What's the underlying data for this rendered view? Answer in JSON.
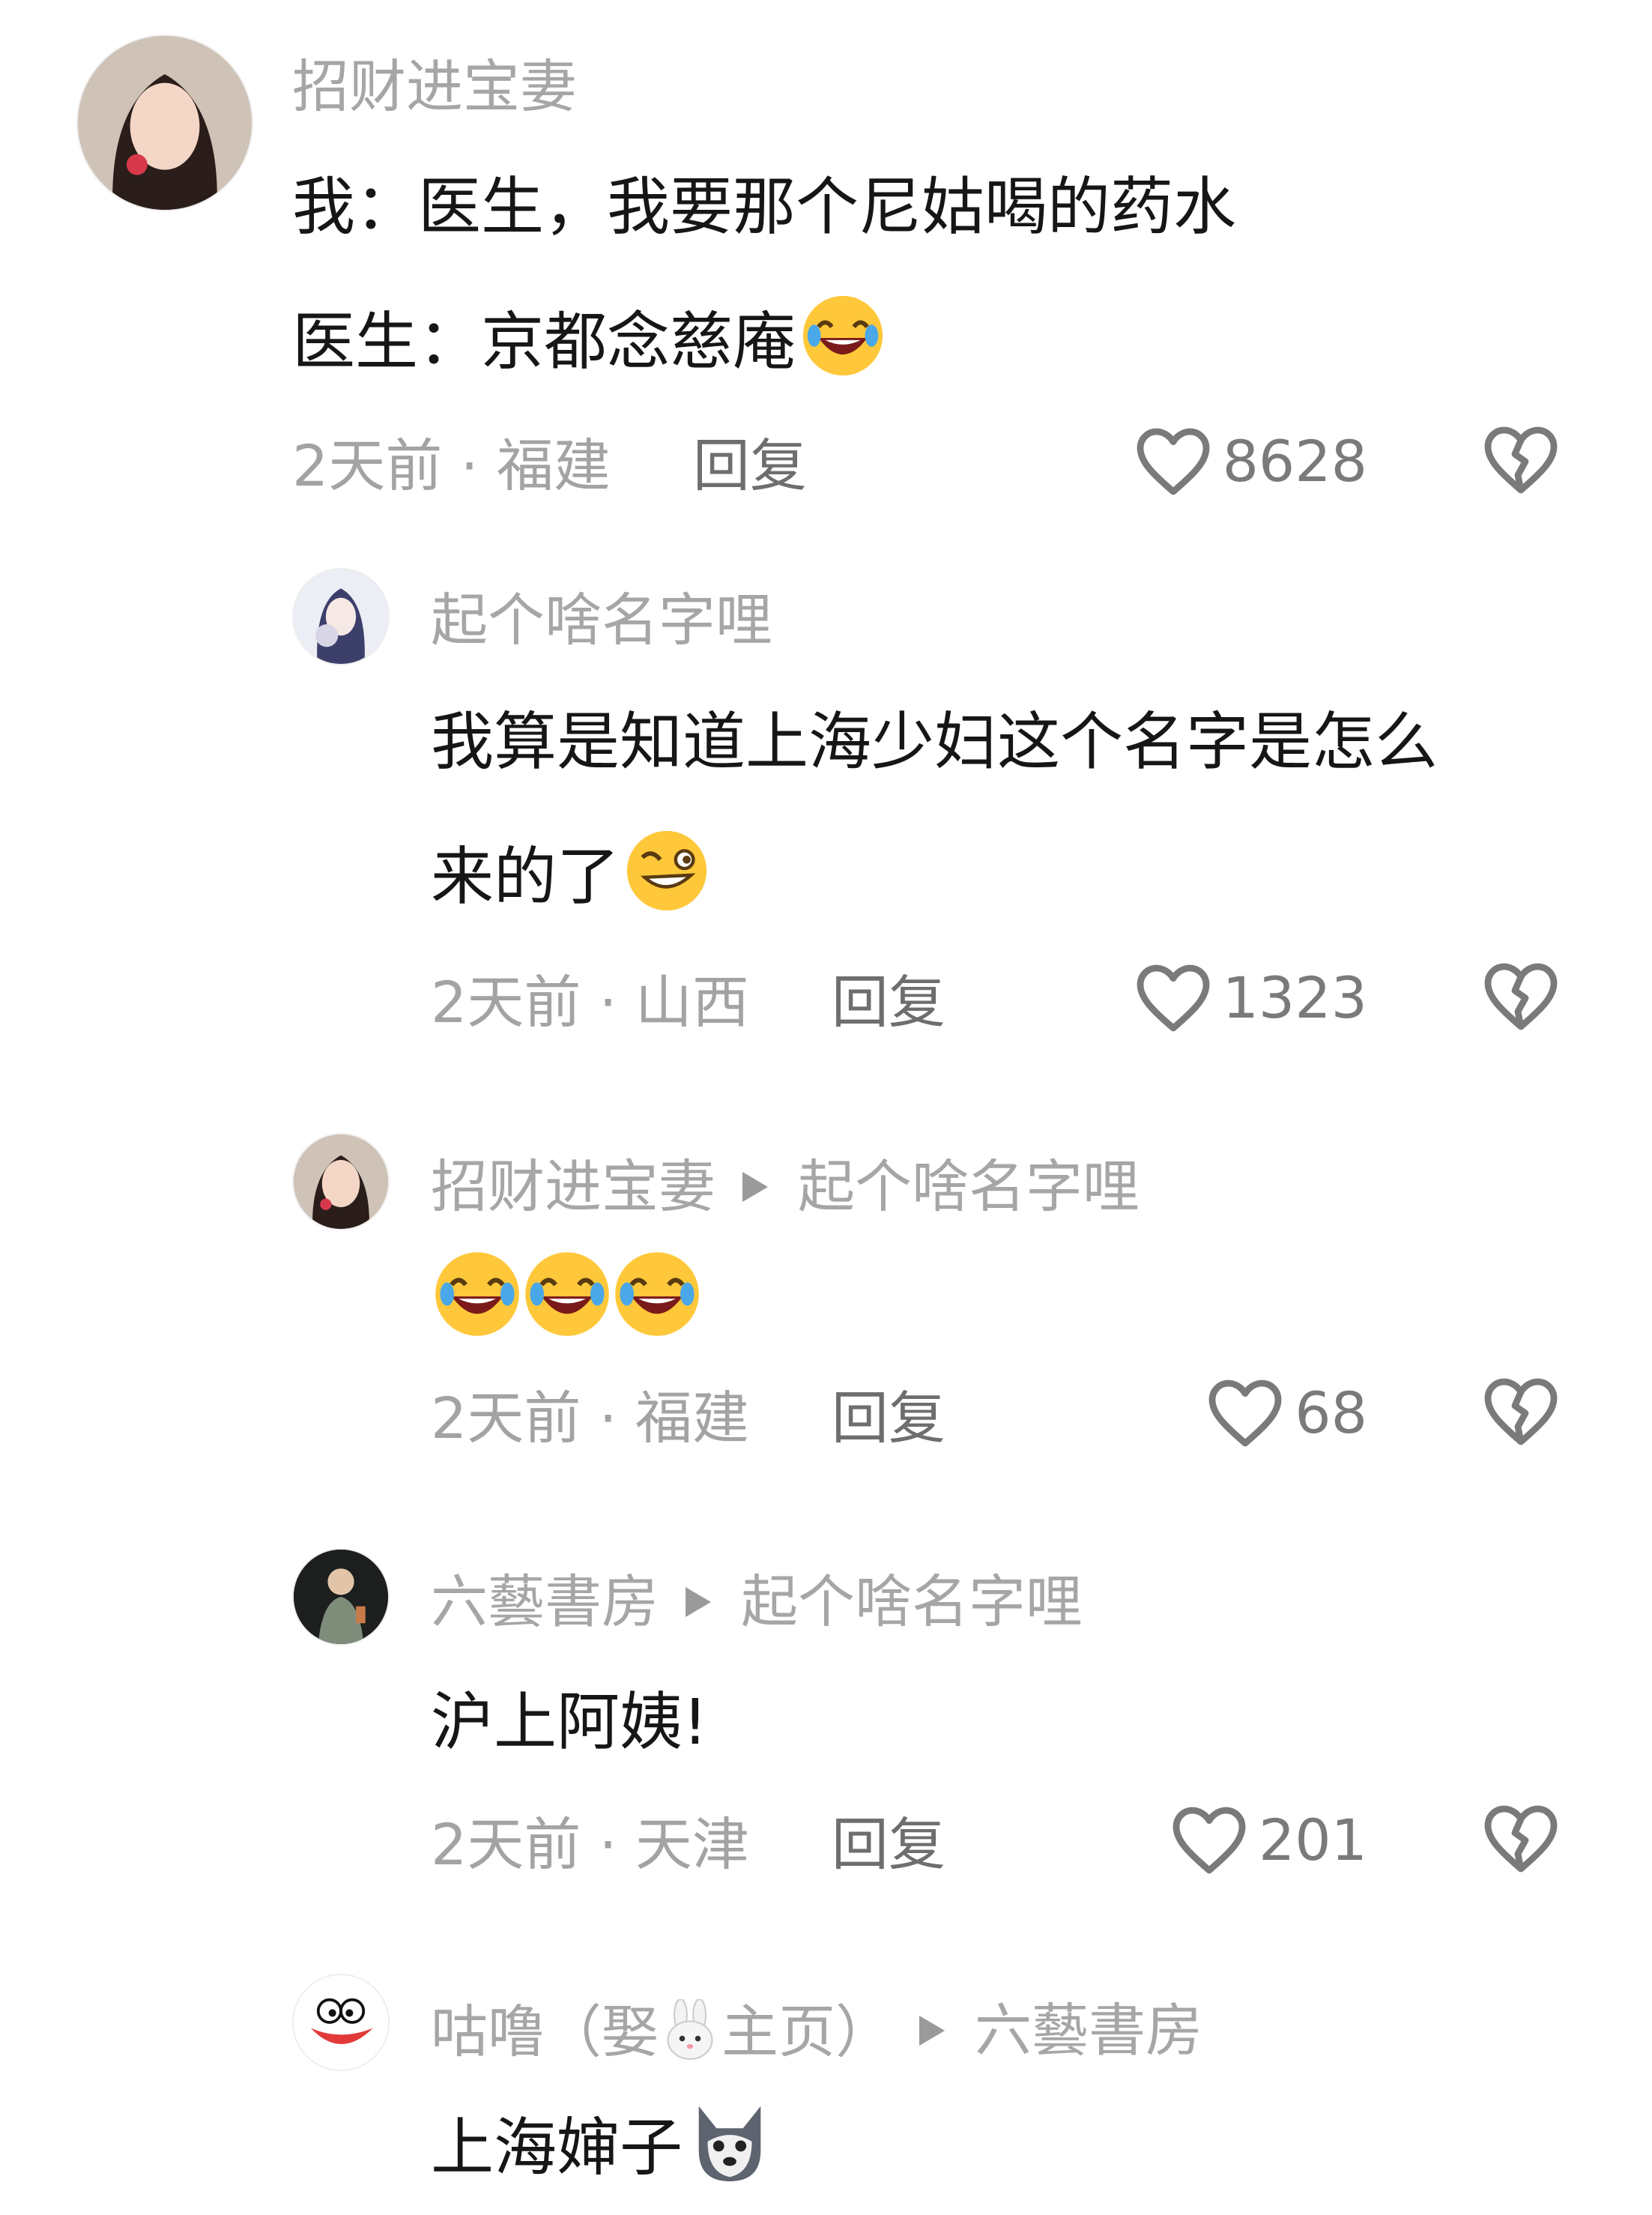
{
  "comments": [
    {
      "author": "招财进宝妻",
      "lines": [
        "我：医生，我要那个尼姑喝的药水",
        "医生：京都念慈庵"
      ],
      "emoji_name": "laugh-tears-emoji",
      "time_location": "2天前 · 福建",
      "reply_label": "回复",
      "likes": "8628"
    },
    {
      "author": "起个啥名字哩",
      "lines": [
        "我算是知道上海少妇这个名字是怎么",
        "来的了"
      ],
      "emoji_name": "smirk-wink-emoji",
      "time_location": "2天前 · 山西",
      "reply_label": "回复",
      "likes": "1323"
    },
    {
      "author": "招财进宝妻",
      "reply_to": "起个啥名字哩",
      "emoji_name": "crying-laugh-emoji",
      "time_location": "2天前 · 福建",
      "reply_label": "回复",
      "likes": "68"
    },
    {
      "author": "六藝書房",
      "reply_to": "起个啥名字哩",
      "lines": [
        "沪上阿姨!"
      ],
      "time_location": "2天前 · 天津",
      "reply_label": "回复",
      "likes": "201"
    },
    {
      "author": "咕噜（娶",
      "author_suffix": "主页）",
      "author_emoji": "rabbit-emoji",
      "reply_to": "六藝書房",
      "lines": [
        "上海婶子"
      ],
      "emoji_name": "husky-dog-emoji"
    }
  ],
  "icons": {
    "like": "heart-outline-icon",
    "dislike": "broken-heart-icon"
  },
  "colors": {
    "text": "#161616",
    "secondary": "#a6a6a6",
    "reply": "#6e6e6e"
  }
}
